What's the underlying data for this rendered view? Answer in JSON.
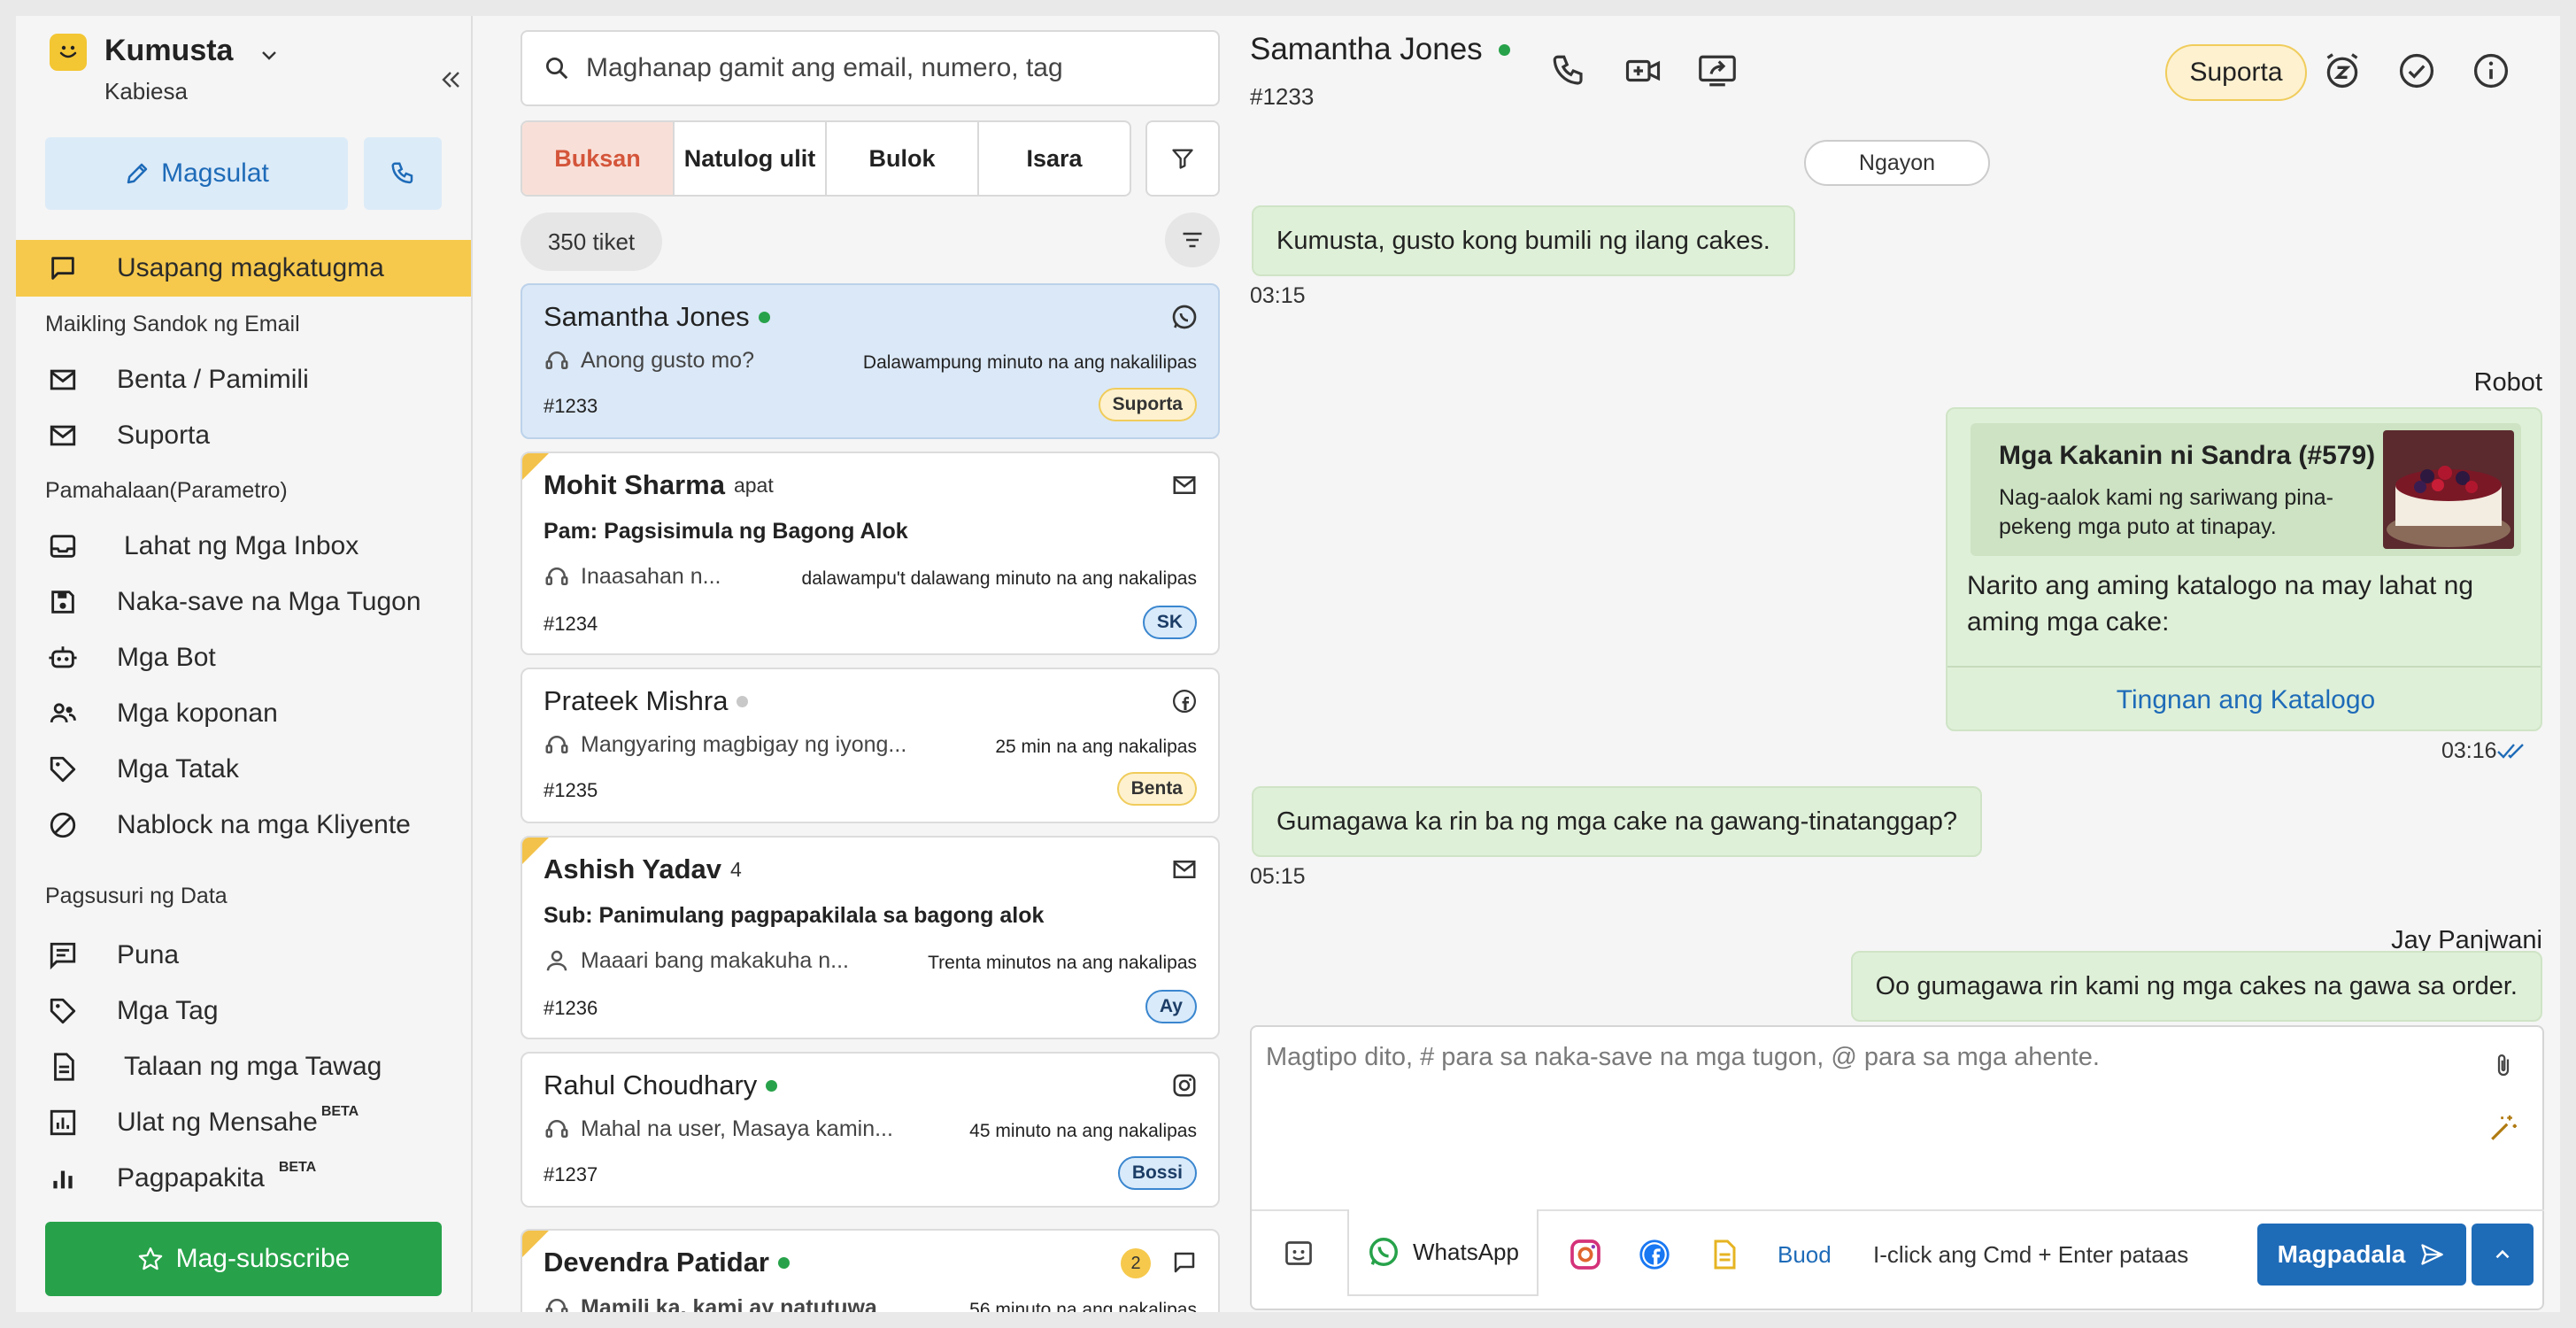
{
  "sidebar": {
    "brand_name": "Kumusta",
    "brand_sub": "Kabiesa",
    "compose_label": "Magsulat",
    "nav_active": "Usapang magkatugma",
    "section_email": "Maikling Sandok ng Email",
    "email_items": [
      "Benta / Pamimili",
      "Suporta"
    ],
    "section_admin": "Pamahalaan(Parametro)",
    "admin_items": [
      "Lahat ng Mga Inbox",
      "Naka-save na Mga Tugon",
      "Mga Bot",
      "Mga koponan",
      "Mga Tatak",
      "Nablock na mga Kliyente"
    ],
    "section_analytics": "Pagsusuri ng Data",
    "analytics_items": [
      "Puna",
      "Mga Tag",
      "Talaan ng mga Tawag",
      "Ulat ng Mensahe",
      "Pagpapakita"
    ],
    "beta": "BETA",
    "subscribe_label": "Mag-subscribe"
  },
  "list": {
    "search_placeholder": "Maghanap gamit ang email, numero, tag",
    "tabs": [
      "Buksan",
      "Natulog ulit",
      "Bulok",
      "Isara"
    ],
    "count": "350 tiket",
    "tickets": [
      {
        "name": "Samantha Jones",
        "presence": "online",
        "channel": "whatsapp-icon",
        "message": "Anong gusto mo?",
        "time": "Dalawampung minuto na ang nakalilipas",
        "id": "#1233",
        "badge": "Suporta"
      },
      {
        "name": "Mohit Sharma",
        "extra": "apat",
        "channel": "email-icon",
        "subject": "Pam: Pagsisimula ng Bagong Alok",
        "message": "Inaasahan n...",
        "time": "dalawampu't dalawang minuto na ang nakalipas",
        "id": "#1234",
        "badge": "SK"
      },
      {
        "name": "Prateek Mishra",
        "presence": "offline",
        "channel": "facebook-icon",
        "message": "Mangyaring magbigay ng iyong...",
        "time": "25 min na ang nakalipas",
        "id": "#1235",
        "badge": "Benta"
      },
      {
        "name": "Ashish Yadav",
        "extra": "4",
        "channel": "email-icon",
        "subject": "Sub: Panimulang pagpapakilala sa bagong alok",
        "message": "Maaari bang makakuha n...",
        "time": "Trenta minutos na ang nakalipas",
        "id": "#1236",
        "badge": "Ay"
      },
      {
        "name": "Rahul Choudhary",
        "presence": "online",
        "channel": "instagram-icon",
        "message": "Mahal na user, Masaya kamin...",
        "time": "45 minuto na ang nakalipas",
        "id": "#1237",
        "badge": "Bossi"
      },
      {
        "name": "Devendra Patidar",
        "presence": "online",
        "unread": "2",
        "channel": "chat-icon",
        "message": "Mamili ka, kami ay natutuwa",
        "time": "56 minuto na ang nakalipas"
      }
    ]
  },
  "chat": {
    "contact_name": "Samantha Jones",
    "contact_id": "#1233",
    "tag": "Suporta",
    "date_label": "Ngayon",
    "messages": {
      "m1": "Kumusta, gusto kong bumili ng ilang cakes.",
      "m1_time": "03:15",
      "robot_sender": "Robot",
      "tmpl_title": "Mga Kakanin ni Sandra (#579)",
      "tmpl_desc": "Nag-aalok kami ng sariwang pina-pekeng mga puto at tinapay.",
      "tmpl_body": "Narito ang aming katalogo na may lahat ng aming mga cake:",
      "tmpl_link": "Tingnan ang Katalogo",
      "tmpl_time": "03:16",
      "m3": "Gumagawa ka rin ba ng mga cake na gawang-tinatanggap?",
      "m3_time": "05:15",
      "agent_sender": "Jay Panjwani",
      "m4": "Oo gumagawa rin kami ng mga cakes na gawa sa order."
    },
    "composer": {
      "placeholder": "Magtipo dito, # para sa naka-save na mga tugon, @ para sa mga ahente.",
      "channel": "WhatsApp",
      "summary": "Buod",
      "hint": "I-click ang Cmd + Enter pataas",
      "send": "Magpadala"
    }
  },
  "colors": {
    "accent": "#1e6bb8",
    "brand_yellow": "#f6c94c",
    "online": "#27a24a",
    "bubble": "#dff0d8"
  }
}
